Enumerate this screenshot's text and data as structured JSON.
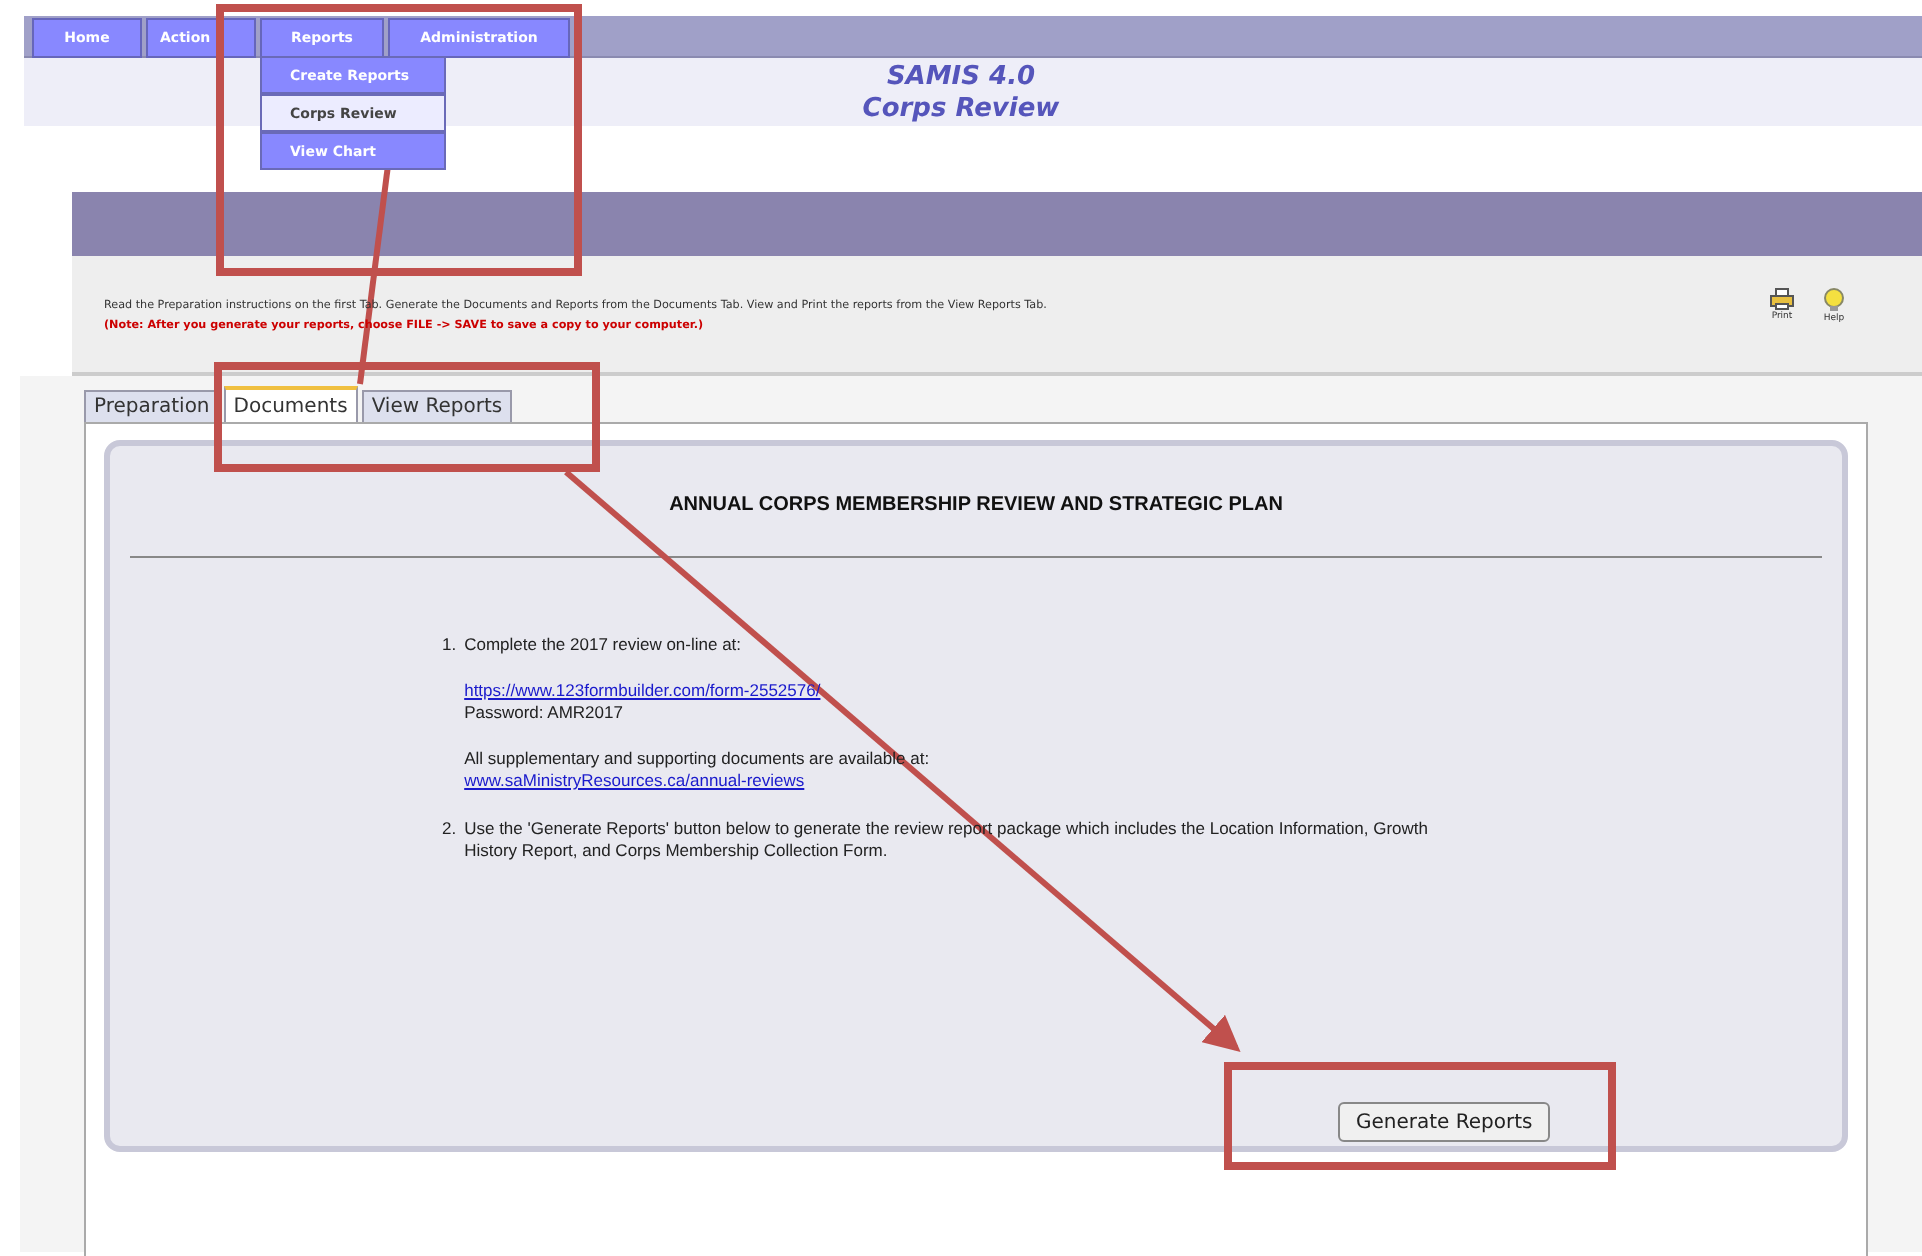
{
  "nav": {
    "items": [
      {
        "label": "Home",
        "open": false
      },
      {
        "label": "Action",
        "open": false
      },
      {
        "label": "Reports",
        "open": true
      },
      {
        "label": "Administration",
        "open": false
      }
    ],
    "menu": [
      {
        "label": "Create Reports",
        "selected": false
      },
      {
        "label": "Corps Review",
        "selected": true
      },
      {
        "label": "View Chart",
        "selected": false
      }
    ]
  },
  "header": {
    "title": "SAMIS 4.0",
    "subtitle": "Corps Review"
  },
  "instructions": {
    "text": "Read the Preparation instructions on the first Tab. Generate the Documents and Reports from the Documents Tab. View and Print the reports from the View Reports Tab.",
    "note": "(Note: After you generate your reports, choose FILE -> SAVE to save a copy to your computer.)",
    "tools": [
      {
        "kind": "print",
        "label": "Print"
      },
      {
        "kind": "help",
        "label": "Help"
      }
    ]
  },
  "tabs": [
    {
      "label": "Preparation",
      "selected": false
    },
    {
      "label": "Documents",
      "selected": true
    },
    {
      "label": "View Reports",
      "selected": false
    }
  ],
  "document": {
    "heading": "ANNUAL CORPS MEMBERSHIP REVIEW AND STRATEGIC PLAN",
    "steps": [
      {
        "number": "1.",
        "text": "Complete the 2017 review on-line at:",
        "link": "https://www.123formbuilder.com/form-2552576/",
        "password": "Password: AMR2017",
        "extra": "All supplementary and supporting documents are available at:",
        "extra_link": "www.saMinistryResources.ca/annual-reviews"
      },
      {
        "number": "2.",
        "text": "Use the 'Generate Reports' button below to generate the review report package which includes the Location Information, Growth History Report, and Corps Membership Collection Form."
      }
    ],
    "button": "Generate Reports"
  }
}
